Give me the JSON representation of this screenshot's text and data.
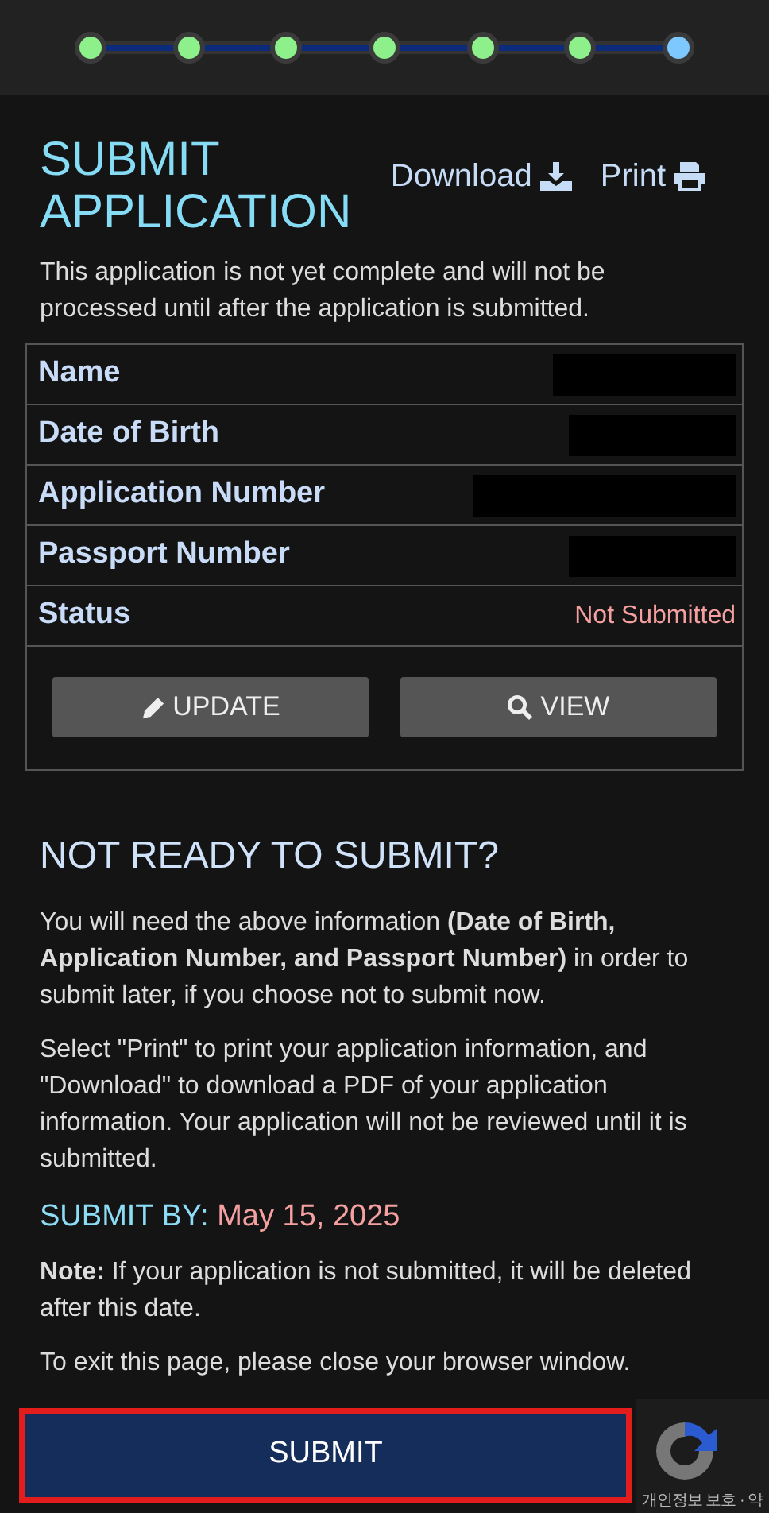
{
  "progress": {
    "steps": [
      {
        "current": false
      },
      {
        "current": false
      },
      {
        "current": false
      },
      {
        "current": false
      },
      {
        "current": false
      },
      {
        "current": false
      },
      {
        "current": true
      }
    ]
  },
  "title": "SUBMIT APPLICATION",
  "actions": [
    {
      "label": "Download"
    },
    {
      "label": "Print"
    }
  ],
  "intro": "This application is not yet complete and will not be processed until after the application is submitted.",
  "summary": {
    "rows": [
      {
        "label": "Name",
        "redacted": true
      },
      {
        "label": "Date of Birth",
        "redacted": true
      },
      {
        "label": "Application Number",
        "redacted": true
      },
      {
        "label": "Passport Number",
        "redacted": true
      },
      {
        "label": "Status",
        "value": "Not Submitted"
      }
    ],
    "buttons": [
      {
        "label": "UPDATE"
      },
      {
        "label": "VIEW"
      }
    ]
  },
  "section_title": "NOT READY TO SUBMIT?",
  "paragraphs": [
    "You will need the above information **(Date of Birth, Application Number, and Passport Number)** in order to submit later, if you choose not to submit now.",
    "Select \"Print\" to print your application information, and \"Download\" to download a PDF of your application information. Your application will not be reviewed until it is submitted."
  ],
  "deadline": {
    "label": "SUBMIT BY:",
    "date": "May 15, 2025"
  },
  "note": "**Note:** If your application is not submitted, it will be deleted after this date.",
  "exit_text": "To exit this page, please close your browser window.",
  "submit_button": {
    "label": "SUBMIT",
    "highlighted": true
  },
  "captcha_badge": {
    "text": "개인정보 보호 · 약"
  }
}
